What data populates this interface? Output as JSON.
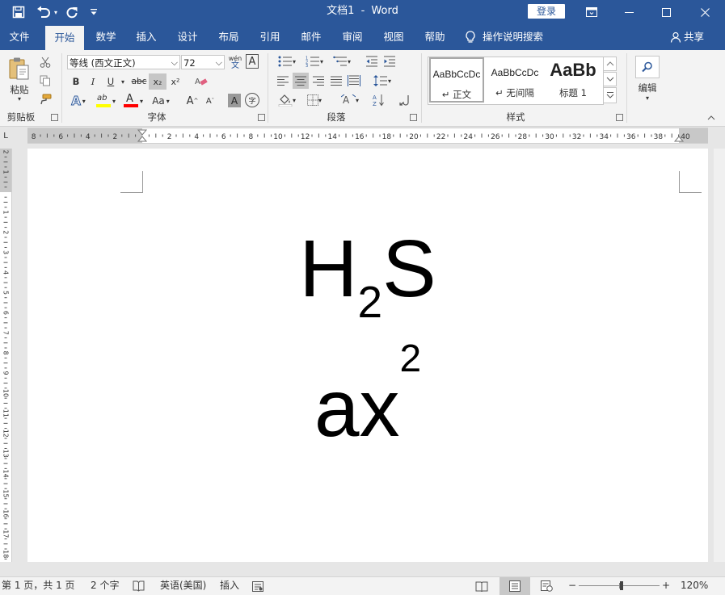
{
  "titlebar": {
    "doc_title": "文档1",
    "separator": "-",
    "app_name": "Word",
    "login_label": "登录",
    "icons": {
      "save": "save-icon",
      "undo": "undo-icon",
      "redo": "redo-icon",
      "customize": "customize-qat-icon",
      "ribbon_display": "ribbon-display-icon",
      "minimize": "minimize-icon",
      "maximize": "maximize-icon",
      "close": "close-icon"
    }
  },
  "menu": {
    "tabs": [
      {
        "label": "文件"
      },
      {
        "label": "开始"
      },
      {
        "label": "数学"
      },
      {
        "label": "插入"
      },
      {
        "label": "设计"
      },
      {
        "label": "布局"
      },
      {
        "label": "引用"
      },
      {
        "label": "邮件"
      },
      {
        "label": "审阅"
      },
      {
        "label": "视图"
      },
      {
        "label": "帮助"
      }
    ],
    "active_tab": "开始",
    "search_label": "操作说明搜索",
    "share_label": "共享"
  },
  "ribbon": {
    "clipboard": {
      "paste_label": "粘贴",
      "group_label": "剪贴板"
    },
    "font": {
      "font_name": "等线 (西文正文)",
      "font_size": "72",
      "phonetic_top": "wén",
      "phonetic_bottom": "文",
      "border_char": "A",
      "bold": "B",
      "italic": "I",
      "underline": "U",
      "strike": "abc",
      "subscript": "x₂",
      "superscript": "x²",
      "effects": "A",
      "highlight": "ab",
      "font_color": "A",
      "change_case": "Aa",
      "grow": "A",
      "shrink": "A",
      "shading": "A",
      "enclose": "字",
      "group_label": "字体"
    },
    "paragraph": {
      "group_label": "段落"
    },
    "styles": {
      "items": [
        {
          "preview": "AaBbCcDc",
          "name": "↵ 正文"
        },
        {
          "preview": "AaBbCcDc",
          "name": "↵ 无间隔"
        },
        {
          "preview": "AaBb",
          "name": "标题 1"
        }
      ],
      "group_label": "样式"
    },
    "editing": {
      "label": "编辑"
    }
  },
  "ruler": {
    "corner_symbol": "L",
    "h_labels": [
      "8",
      "6",
      "4",
      "2",
      "",
      "2",
      "4",
      "6",
      "8",
      "10",
      "12",
      "14",
      "16",
      "18",
      "20",
      "22",
      "24",
      "26",
      "28",
      "30",
      "32",
      "34",
      "36",
      "38",
      "40"
    ],
    "v_labels": [
      "2",
      "1",
      "",
      "1",
      "2",
      "3",
      "4",
      "5",
      "6",
      "7",
      "8",
      "9",
      "10",
      "11",
      "12",
      "13",
      "14",
      "15",
      "16",
      "17",
      "18"
    ]
  },
  "document": {
    "line1": {
      "base1": "H",
      "sub": "2",
      "base2": "S"
    },
    "line2": {
      "base": "ax",
      "sup": "2"
    }
  },
  "statusbar": {
    "page_info": "第 1 页，共 1 页",
    "word_count": "2 个字",
    "language": "英语(美国)",
    "insert_mode": "插入",
    "zoom_minus": "−",
    "zoom_plus": "+",
    "zoom_level": "120%"
  },
  "colors": {
    "accent": "#2b579a",
    "ribbon_bg": "#f3f3f3",
    "highlight_bar": "#ffff00",
    "font_color_bar": "#ff0000"
  }
}
